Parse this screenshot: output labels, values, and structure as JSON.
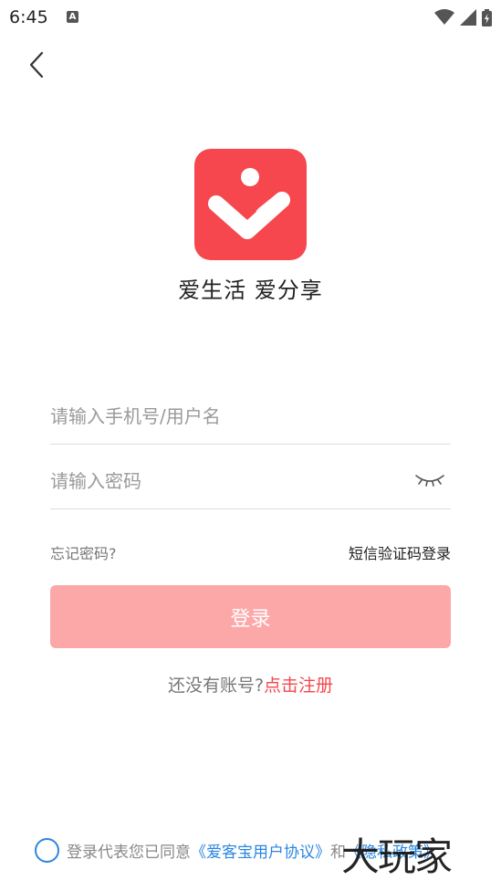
{
  "status_bar": {
    "time": "6:45",
    "notification_letter": "A"
  },
  "header": {
    "back_icon": "chevron-left-icon"
  },
  "brand": {
    "logo_color": "#f5474d",
    "slogan": "爱生活 爱分享"
  },
  "form": {
    "username_placeholder": "请输入手机号/用户名",
    "username_value": "",
    "password_placeholder": "请输入密码",
    "password_value": "",
    "password_toggle_icon": "eye-closed-icon"
  },
  "links": {
    "forgot_password": "忘记密码?",
    "sms_login": "短信验证码登录"
  },
  "login_button": {
    "label": "登录",
    "color": "#fda8a8"
  },
  "register": {
    "question": "还没有账号?",
    "link": "点击注册",
    "link_color": "#f5474d"
  },
  "agreement": {
    "prefix": "登录代表您已同意",
    "user_agreement": "《爱客宝用户协议》",
    "conjunction": "和",
    "privacy_policy": "《隐私政策》",
    "checked": false
  },
  "watermark": {
    "text": "大玩家"
  }
}
